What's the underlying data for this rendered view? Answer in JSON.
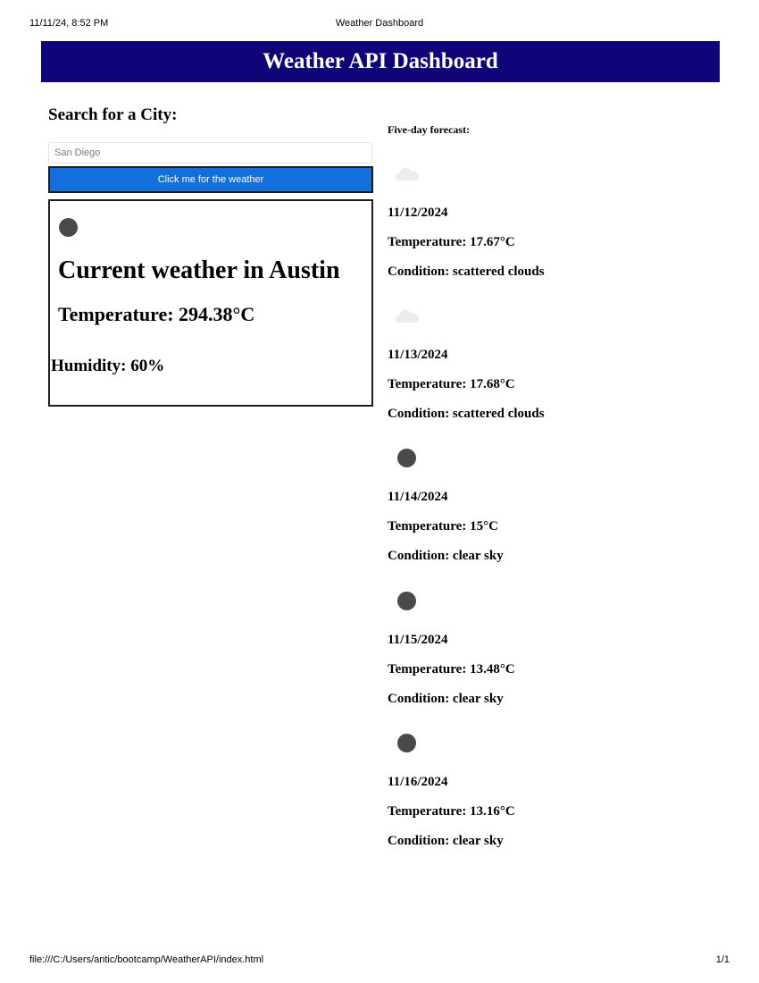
{
  "print_header": {
    "datetime": "11/11/24, 8:52 PM",
    "doc_title": "Weather Dashboard"
  },
  "print_footer": {
    "url": "file:///C:/Users/antic/bootcamp/WeatherAPI/index.html",
    "page": "1/1"
  },
  "header": {
    "title": "Weather API Dashboard",
    "background": "#0f0578"
  },
  "search": {
    "heading": "Search for a City:",
    "placeholder": "San Diego",
    "button_label": "Click me for the weather",
    "button_color": "#136fdc"
  },
  "current": {
    "icon": "moon-icon",
    "title": "Current weather in Austin",
    "temperature": "Temperature: 294.38°C",
    "humidity": "Humidity: 60%"
  },
  "forecast": {
    "heading": "Five-day forecast:",
    "days": [
      {
        "icon": "cloud-icon",
        "date": "11/12/2024",
        "temperature": "Temperature: 17.67°C",
        "condition": "Condition: scattered clouds"
      },
      {
        "icon": "cloud-icon",
        "date": "11/13/2024",
        "temperature": "Temperature: 17.68°C",
        "condition": "Condition: scattered clouds"
      },
      {
        "icon": "moon-icon",
        "date": "11/14/2024",
        "temperature": "Temperature: 15°C",
        "condition": "Condition: clear sky"
      },
      {
        "icon": "moon-icon",
        "date": "11/15/2024",
        "temperature": "Temperature: 13.48°C",
        "condition": "Condition: clear sky"
      },
      {
        "icon": "moon-icon",
        "date": "11/16/2024",
        "temperature": "Temperature: 13.16°C",
        "condition": "Condition: clear sky"
      }
    ]
  }
}
